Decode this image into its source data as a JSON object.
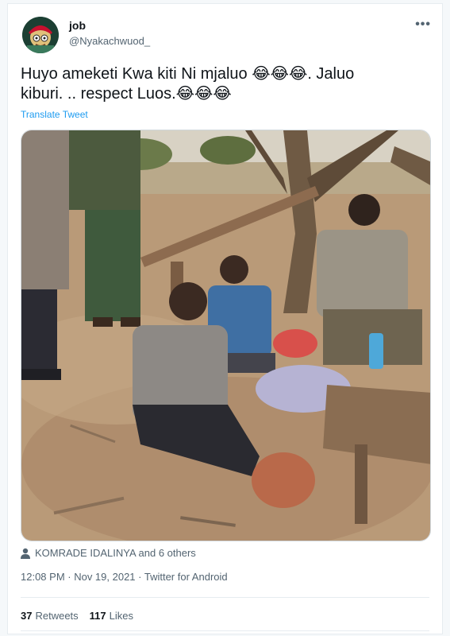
{
  "user": {
    "name": "job",
    "handle": "@Nyakachwuod_"
  },
  "tweet": {
    "text_line1": "Huyo ameketi Kwa kiti Ni mjaluo 😂😂😂.  Jaluo",
    "text_line2": "kiburi. .. respect Luos.😂😂😂",
    "translate": "Translate Tweet"
  },
  "likers": "KOMRADE IDALINYA and 6 others",
  "meta": {
    "timestamp": "12:08 PM · Nov 19, 2021 · Twitter for Android"
  },
  "stats": {
    "retweets_count": "37",
    "retweets_label": "Retweets",
    "likes_count": "117",
    "likes_label": "Likes"
  },
  "icons": {
    "more": "more-options-icon",
    "person": "person-icon"
  }
}
